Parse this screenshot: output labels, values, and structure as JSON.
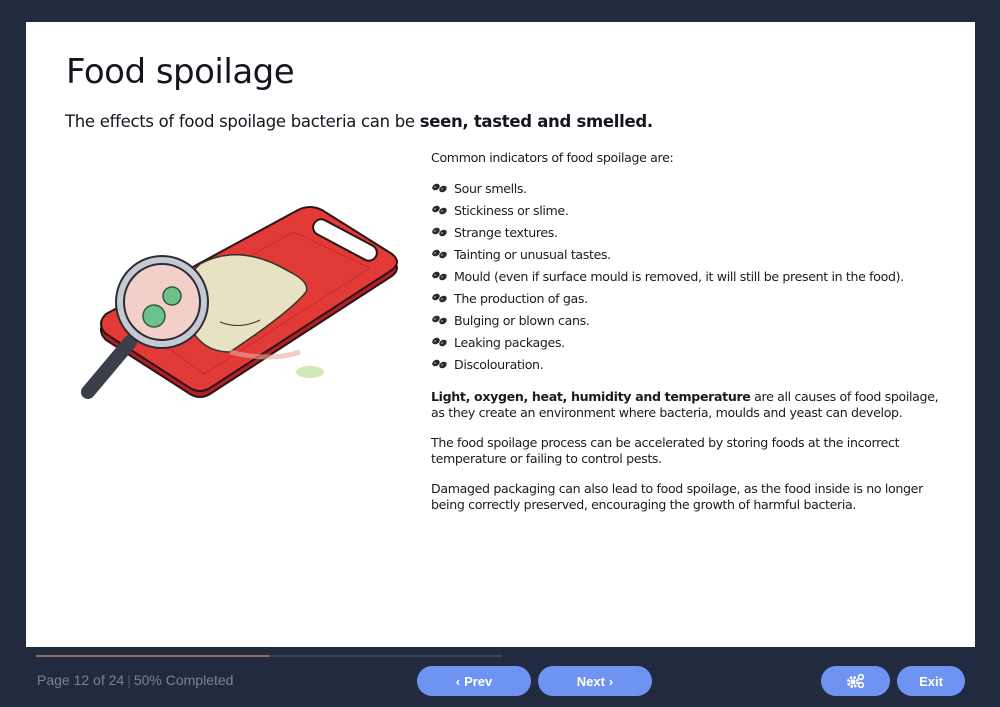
{
  "slide": {
    "title": "Food spoilage",
    "subtitle_prefix": "The effects of food spoilage bacteria can be ",
    "subtitle_bold": "seen, tasted and smelled.",
    "illustration_alt": "Magnifying glass over spoiled chicken on a red cutting board showing bacteria",
    "intro": "Common indicators of food spoilage are:",
    "bullet_icon": "bacteria-icon",
    "indicators": [
      "Sour smells.",
      "Stickiness or slime.",
      "Strange textures.",
      "Tainting or unusual tastes.",
      "Mould (even if surface mould is removed, it will still be present in the food).",
      "The production of gas.",
      "Bulging or blown cans.",
      "Leaking packages.",
      "Discolouration."
    ],
    "para1_bold": "Light, oxygen, heat, humidity and temperature",
    "para1_rest": " are all causes of food spoilage, as they create an environment where bacteria, moulds and yeast can develop.",
    "para2": "The food spoilage process can be accelerated by storing foods at the incorrect temperature or failing to control pests.",
    "para3": "Damaged packaging can also lead to food spoilage, as the food inside is no longer being correctly preserved, encouraging the growth of harmful bacteria."
  },
  "footer": {
    "page_label": "Page 12 of 24",
    "separator": "|",
    "completed_label": "50% Completed",
    "progress_fraction": 0.5,
    "prev_label": "Prev",
    "next_label": "Next",
    "prev_icon": "chevron-left-icon",
    "next_icon": "chevron-right-icon",
    "settings_icon": "gears-icon",
    "exit_label": "Exit"
  },
  "colors": {
    "background": "#212a3f",
    "button": "#6e93f0",
    "progress_fill": "#8a6e5e",
    "board_red": "#e23a36"
  }
}
